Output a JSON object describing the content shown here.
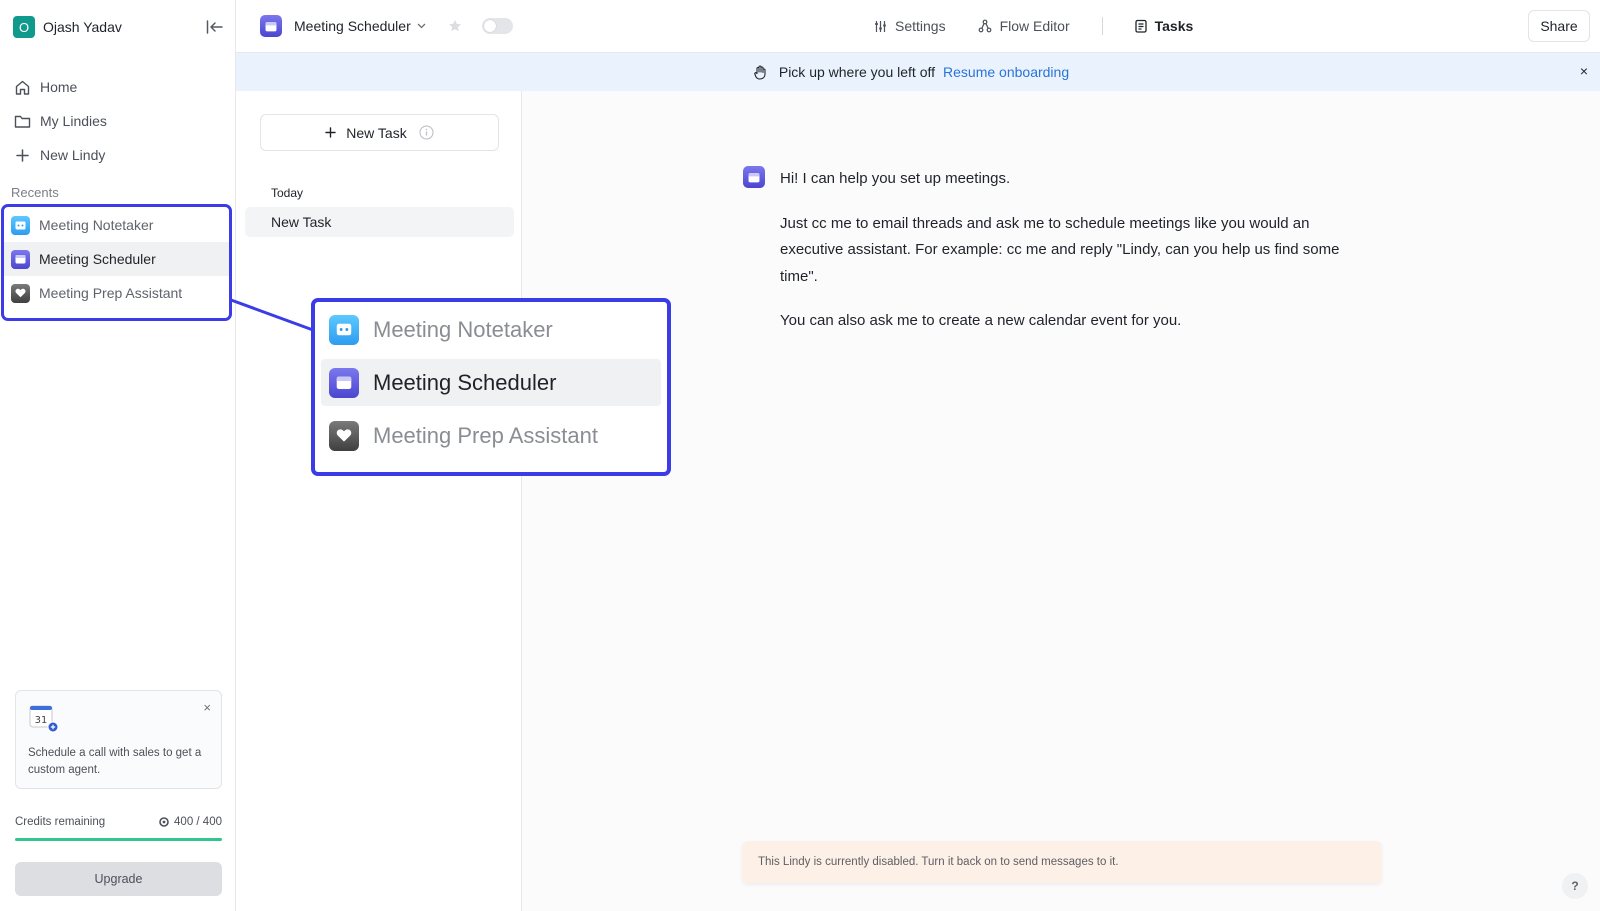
{
  "account": {
    "initial": "O",
    "name": "Ojash Yadav"
  },
  "nav": [
    {
      "label": "Home",
      "icon": "home-icon"
    },
    {
      "label": "My Lindies",
      "icon": "folder-icon"
    },
    {
      "label": "New Lindy",
      "icon": "plus-icon"
    }
  ],
  "recents": {
    "title": "Recents",
    "items": [
      {
        "label": "Meeting Notetaker",
        "icon": "notetaker-app-icon",
        "active": false
      },
      {
        "label": "Meeting Scheduler",
        "icon": "scheduler-app-icon",
        "active": true
      },
      {
        "label": "Meeting Prep Assistant",
        "icon": "prep-assistant-app-icon",
        "active": false
      }
    ]
  },
  "sales_card": {
    "calendar_day": "31",
    "close": "×",
    "text": "Schedule a call with sales to get a custom agent."
  },
  "credits": {
    "label": "Credits remaining",
    "value": "400 / 400",
    "fraction": 1.0
  },
  "upgrade_label": "Upgrade",
  "topbar": {
    "agent_name": "Meeting Scheduler",
    "tabs": {
      "settings": "Settings",
      "flow_editor": "Flow Editor",
      "tasks": "Tasks"
    },
    "share_label": "Share"
  },
  "banner": {
    "text": "Pick up where you left off",
    "link": "Resume onboarding",
    "close": "×"
  },
  "tasks": {
    "new_task_label": "New Task",
    "group_label": "Today",
    "items": [
      "New Task"
    ]
  },
  "chat": {
    "messages": [
      "Hi! I can help you set up meetings.",
      "Just cc me to email threads and ask me to schedule meetings like you would an executive assistant. For example: cc me and reply \"Lindy, can you help us find some time\".",
      "You can also ask me to create a new calendar event for you."
    ],
    "disabled_note": "This Lindy is currently disabled. Turn it back on to send messages to it.",
    "help": "?"
  },
  "colors": {
    "accent_blue": "#3b3be8",
    "link": "#2a73d9",
    "banner_bg": "#eaf3fd",
    "credits_fill": "#2fc68f",
    "avatar_bg": "#109a8e"
  }
}
